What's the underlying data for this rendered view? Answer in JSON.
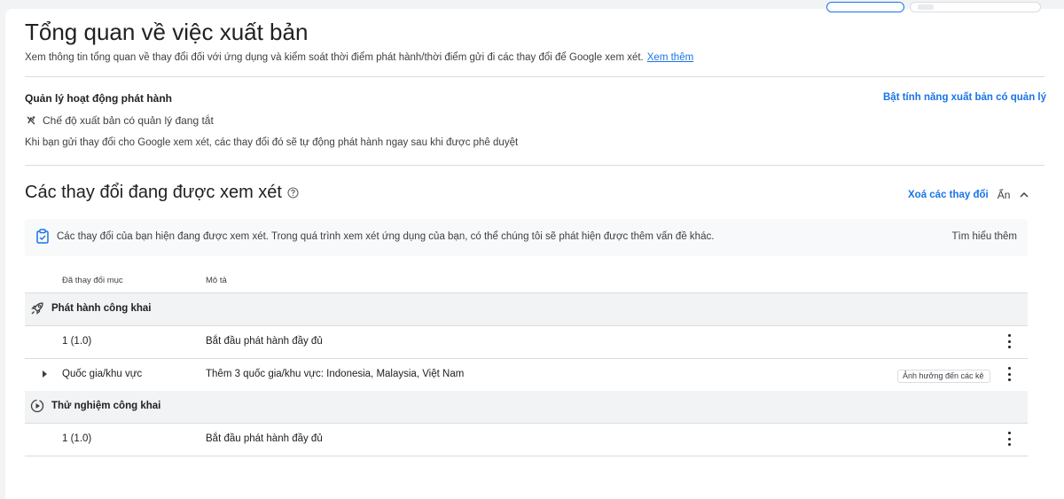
{
  "header": {
    "title": "Tổng quan về việc xuất bản",
    "subtitle": "Xem thông tin tổng quan về thay đổi đối với ứng dụng và kiểm soát thời điểm phát hành/thời điểm gửi đi các thay đổi để Google xem xét.",
    "learn_more": "Xem thêm"
  },
  "managed": {
    "section_label": "Quản lý hoạt động phát hành",
    "enable_link": "Bật tính năng xuất bản có quản lý",
    "status": "Chế độ xuất bản có quản lý đang tắt",
    "status_icon": "publish-off-icon",
    "info": "Khi bạn gửi thay đổi cho Google xem xét, các thay đổi đó sẽ tự động phát hành ngay sau khi được phê duyệt"
  },
  "review": {
    "title": "Các thay đổi đang được xem xét",
    "help_icon": "help-circle-icon",
    "remove_link": "Xoá các thay đổi",
    "hide_label": "Ẩn",
    "notice_text": "Các thay đổi của bạn hiện đang được xem xét. Trong quá trình xem xét ứng dụng của bạn, có thể chúng tôi sẽ phát hiện được thêm vấn đề khác.",
    "notice_learn": "Tìm hiểu thêm",
    "notice_icon": "review-clipboard-icon"
  },
  "table": {
    "columns": [
      "Đã thay đổi mục",
      "Mô tả"
    ],
    "groups": [
      {
        "name": "Phát hành công khai",
        "icon": "rocket-icon",
        "rows": [
          {
            "item": "1 (1.0)",
            "description": "Bắt đầu phát hành đầy đủ"
          },
          {
            "item": "Quốc gia/khu vực",
            "description": "Thêm 3 quốc gia/khu vực: Indonesia, Malaysia, Việt Nam",
            "badge": "Ảnh hưởng đến các kê"
          }
        ]
      },
      {
        "name": "Thử nghiệm công khai",
        "icon": "play-circle-icon",
        "rows": [
          {
            "item": "1 (1.0)",
            "description": "Bắt đầu phát hành đầy đủ"
          }
        ]
      }
    ]
  },
  "colors": {
    "accent": "#1a73e8",
    "text": "#202124",
    "group_bg": "#f1f3f4",
    "divider": "#dadce0"
  }
}
